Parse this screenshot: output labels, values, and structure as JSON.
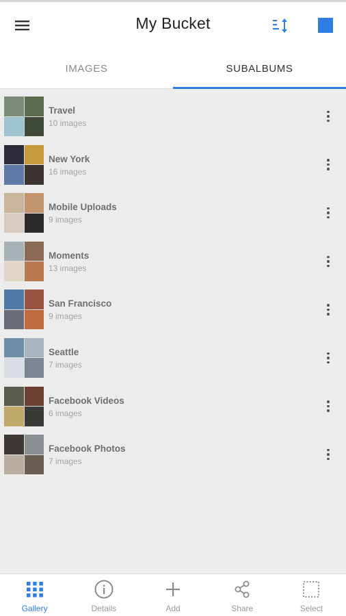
{
  "header": {
    "title": "My Bucket",
    "menu_icon": "hamburger-menu-icon",
    "sort_icon": "sort-icon",
    "select_icon": "square-icon",
    "accent": "#2f7de1"
  },
  "tabs": [
    {
      "label": "IMAGES",
      "active": false
    },
    {
      "label": "SUBALBUMS",
      "active": true
    }
  ],
  "albums": [
    {
      "name": "Travel",
      "count": "10 images",
      "colors": [
        "#7d8b7a",
        "#5b6b4e",
        "#9fc4cf",
        "#3f4a3a"
      ]
    },
    {
      "name": "New York",
      "count": "16 images",
      "colors": [
        "#2b2b3a",
        "#c79a3e",
        "#5f79a8",
        "#3a3330"
      ]
    },
    {
      "name": "Mobile Uploads",
      "count": "9 images",
      "colors": [
        "#c9b59b",
        "#c2946e",
        "#d9cbbf",
        "#2a2a2a"
      ]
    },
    {
      "name": "Moments",
      "count": "13 images",
      "colors": [
        "#a8b3b7",
        "#8a6a55",
        "#e3d6c6",
        "#b97a4f"
      ]
    },
    {
      "name": "San Francisco",
      "count": "9 images",
      "colors": [
        "#4f7aa6",
        "#9a5540",
        "#6a6d78",
        "#bf6a42"
      ]
    },
    {
      "name": "Seattle",
      "count": "7 images",
      "colors": [
        "#6f8fa8",
        "#a8b4bf",
        "#d7dde3",
        "#7b8594"
      ]
    },
    {
      "name": "Facebook Videos",
      "count": "6 images",
      "colors": [
        "#5a5b4a",
        "#6b4032",
        "#bfa96a",
        "#3a3a36"
      ]
    },
    {
      "name": "Facebook Photos",
      "count": "7 images",
      "colors": [
        "#3d3a36",
        "#8a8f91",
        "#b9aea0",
        "#6a5d52"
      ]
    }
  ],
  "bottom_nav": [
    {
      "label": "Gallery",
      "icon": "grid-icon",
      "active": true
    },
    {
      "label": "Details",
      "icon": "info-icon",
      "active": false
    },
    {
      "label": "Add",
      "icon": "plus-icon",
      "active": false
    },
    {
      "label": "Share",
      "icon": "share-icon",
      "active": false
    },
    {
      "label": "Select",
      "icon": "select-icon",
      "active": false
    }
  ]
}
